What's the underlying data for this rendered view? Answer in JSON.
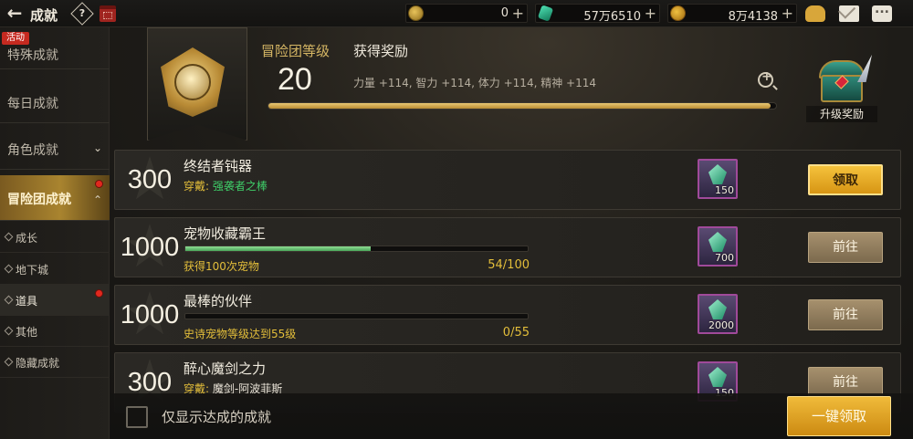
{
  "header_bar": {
    "back_icon": "arrow-left-icon",
    "title": "成就",
    "help_icon_label": "?",
    "calendar_icon": "calendar-icon"
  },
  "currencies": [
    {
      "name": "gold-coin-icon",
      "value": "0",
      "plus": "+"
    },
    {
      "name": "gem-icon",
      "value": "57万6510",
      "plus": "+"
    },
    {
      "name": "coin-icon",
      "value": "8万4138",
      "plus": "+"
    }
  ],
  "top_right_icons": [
    "money-bag-icon",
    "mail-icon",
    "chat-icon"
  ],
  "sidebar": {
    "event_tag": "活动",
    "items": [
      {
        "label": "特殊成就"
      },
      {
        "label": "每日成就"
      },
      {
        "label": "角色成就",
        "chevron": "⌄"
      },
      {
        "label": "冒险团成就",
        "chevron": "⌃"
      }
    ],
    "sub_items": [
      {
        "label": "成长"
      },
      {
        "label": "地下城"
      },
      {
        "label": "道具"
      },
      {
        "label": "其他"
      },
      {
        "label": "隐藏成就"
      }
    ]
  },
  "adventure": {
    "level_label": "冒险团等级",
    "level_value": "20",
    "reward_title": "获得奖励",
    "reward_desc": "力量 +114, 智力 +114, 体力 +114, 精神 +114",
    "level_progress": 0.99,
    "chest_label": "升级奖励"
  },
  "achievements": [
    {
      "points": "300",
      "name": "终结者钝器",
      "desc_prefix": "穿戴: ",
      "desc": "强袭者之棒",
      "has_progress": false,
      "reward_qty": "150",
      "button": "领取",
      "button_type": "claim"
    },
    {
      "points": "1000",
      "name": "宠物收藏霸王",
      "desc": "获得100次宠物",
      "has_progress": true,
      "progress": 0.54,
      "count": "54/100",
      "reward_qty": "700",
      "button": "前往",
      "button_type": "go"
    },
    {
      "points": "1000",
      "name": "最棒的伙伴",
      "desc": "史诗宠物等级达到55级",
      "has_progress": true,
      "progress": 0.0,
      "count": "0/55",
      "reward_qty": "2000",
      "button": "前往",
      "button_type": "go"
    },
    {
      "points": "300",
      "name": "醉心魔剑之力",
      "desc_prefix": "穿戴: ",
      "desc": "魔剑-阿波菲斯",
      "has_progress": false,
      "reward_qty": "150",
      "button": "前往",
      "button_type": "go"
    }
  ],
  "bottom": {
    "checkbox_label": "仅显示达成的成就",
    "claim_all": "一键领取"
  }
}
